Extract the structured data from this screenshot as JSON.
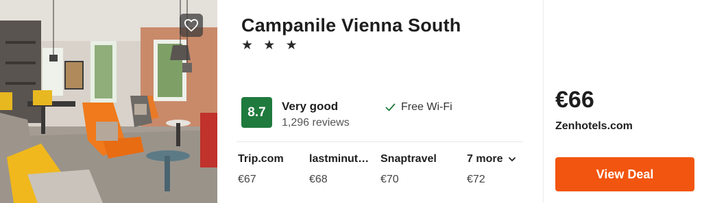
{
  "hotel": {
    "name": "Campanile Vienna South",
    "stars": "★ ★ ★"
  },
  "rating": {
    "score": "8.7",
    "label": "Very good",
    "reviews": "1,296 reviews",
    "badge_color": "#1f7a3d"
  },
  "amenities": [
    "Free Wi-Fi"
  ],
  "providers": [
    {
      "name": "Trip.com",
      "price": "€67"
    },
    {
      "name": "lastminute.com",
      "price": "€68"
    },
    {
      "name": "Snaptravel",
      "price": "€70"
    }
  ],
  "more": {
    "label": "7 more",
    "price": "€72"
  },
  "best": {
    "price": "€66",
    "provider": "Zenhotels.com"
  },
  "cta": {
    "label": "View Deal",
    "color": "#f2550f"
  },
  "icons": {
    "favorite": "heart-icon",
    "amenity": "check-icon",
    "more": "chevron-down-icon"
  }
}
